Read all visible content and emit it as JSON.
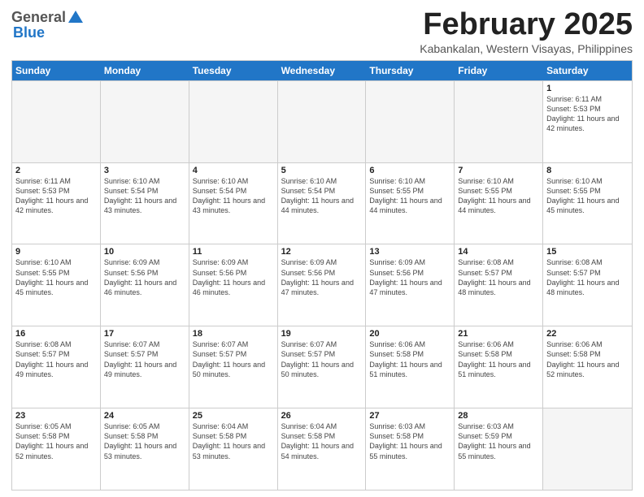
{
  "header": {
    "logo_general": "General",
    "logo_blue": "Blue",
    "month_title": "February 2025",
    "location": "Kabankalan, Western Visayas, Philippines"
  },
  "calendar": {
    "days_of_week": [
      "Sunday",
      "Monday",
      "Tuesday",
      "Wednesday",
      "Thursday",
      "Friday",
      "Saturday"
    ],
    "rows": [
      [
        {
          "day": "",
          "info": "",
          "empty": true
        },
        {
          "day": "",
          "info": "",
          "empty": true
        },
        {
          "day": "",
          "info": "",
          "empty": true
        },
        {
          "day": "",
          "info": "",
          "empty": true
        },
        {
          "day": "",
          "info": "",
          "empty": true
        },
        {
          "day": "",
          "info": "",
          "empty": true
        },
        {
          "day": "1",
          "info": "Sunrise: 6:11 AM\nSunset: 5:53 PM\nDaylight: 11 hours and 42 minutes.",
          "empty": false
        }
      ],
      [
        {
          "day": "2",
          "info": "Sunrise: 6:11 AM\nSunset: 5:53 PM\nDaylight: 11 hours and 42 minutes.",
          "empty": false
        },
        {
          "day": "3",
          "info": "Sunrise: 6:10 AM\nSunset: 5:54 PM\nDaylight: 11 hours and 43 minutes.",
          "empty": false
        },
        {
          "day": "4",
          "info": "Sunrise: 6:10 AM\nSunset: 5:54 PM\nDaylight: 11 hours and 43 minutes.",
          "empty": false
        },
        {
          "day": "5",
          "info": "Sunrise: 6:10 AM\nSunset: 5:54 PM\nDaylight: 11 hours and 44 minutes.",
          "empty": false
        },
        {
          "day": "6",
          "info": "Sunrise: 6:10 AM\nSunset: 5:55 PM\nDaylight: 11 hours and 44 minutes.",
          "empty": false
        },
        {
          "day": "7",
          "info": "Sunrise: 6:10 AM\nSunset: 5:55 PM\nDaylight: 11 hours and 44 minutes.",
          "empty": false
        },
        {
          "day": "8",
          "info": "Sunrise: 6:10 AM\nSunset: 5:55 PM\nDaylight: 11 hours and 45 minutes.",
          "empty": false
        }
      ],
      [
        {
          "day": "9",
          "info": "Sunrise: 6:10 AM\nSunset: 5:55 PM\nDaylight: 11 hours and 45 minutes.",
          "empty": false
        },
        {
          "day": "10",
          "info": "Sunrise: 6:09 AM\nSunset: 5:56 PM\nDaylight: 11 hours and 46 minutes.",
          "empty": false
        },
        {
          "day": "11",
          "info": "Sunrise: 6:09 AM\nSunset: 5:56 PM\nDaylight: 11 hours and 46 minutes.",
          "empty": false
        },
        {
          "day": "12",
          "info": "Sunrise: 6:09 AM\nSunset: 5:56 PM\nDaylight: 11 hours and 47 minutes.",
          "empty": false
        },
        {
          "day": "13",
          "info": "Sunrise: 6:09 AM\nSunset: 5:56 PM\nDaylight: 11 hours and 47 minutes.",
          "empty": false
        },
        {
          "day": "14",
          "info": "Sunrise: 6:08 AM\nSunset: 5:57 PM\nDaylight: 11 hours and 48 minutes.",
          "empty": false
        },
        {
          "day": "15",
          "info": "Sunrise: 6:08 AM\nSunset: 5:57 PM\nDaylight: 11 hours and 48 minutes.",
          "empty": false
        }
      ],
      [
        {
          "day": "16",
          "info": "Sunrise: 6:08 AM\nSunset: 5:57 PM\nDaylight: 11 hours and 49 minutes.",
          "empty": false
        },
        {
          "day": "17",
          "info": "Sunrise: 6:07 AM\nSunset: 5:57 PM\nDaylight: 11 hours and 49 minutes.",
          "empty": false
        },
        {
          "day": "18",
          "info": "Sunrise: 6:07 AM\nSunset: 5:57 PM\nDaylight: 11 hours and 50 minutes.",
          "empty": false
        },
        {
          "day": "19",
          "info": "Sunrise: 6:07 AM\nSunset: 5:57 PM\nDaylight: 11 hours and 50 minutes.",
          "empty": false
        },
        {
          "day": "20",
          "info": "Sunrise: 6:06 AM\nSunset: 5:58 PM\nDaylight: 11 hours and 51 minutes.",
          "empty": false
        },
        {
          "day": "21",
          "info": "Sunrise: 6:06 AM\nSunset: 5:58 PM\nDaylight: 11 hours and 51 minutes.",
          "empty": false
        },
        {
          "day": "22",
          "info": "Sunrise: 6:06 AM\nSunset: 5:58 PM\nDaylight: 11 hours and 52 minutes.",
          "empty": false
        }
      ],
      [
        {
          "day": "23",
          "info": "Sunrise: 6:05 AM\nSunset: 5:58 PM\nDaylight: 11 hours and 52 minutes.",
          "empty": false
        },
        {
          "day": "24",
          "info": "Sunrise: 6:05 AM\nSunset: 5:58 PM\nDaylight: 11 hours and 53 minutes.",
          "empty": false
        },
        {
          "day": "25",
          "info": "Sunrise: 6:04 AM\nSunset: 5:58 PM\nDaylight: 11 hours and 53 minutes.",
          "empty": false
        },
        {
          "day": "26",
          "info": "Sunrise: 6:04 AM\nSunset: 5:58 PM\nDaylight: 11 hours and 54 minutes.",
          "empty": false
        },
        {
          "day": "27",
          "info": "Sunrise: 6:03 AM\nSunset: 5:58 PM\nDaylight: 11 hours and 55 minutes.",
          "empty": false
        },
        {
          "day": "28",
          "info": "Sunrise: 6:03 AM\nSunset: 5:59 PM\nDaylight: 11 hours and 55 minutes.",
          "empty": false
        },
        {
          "day": "",
          "info": "",
          "empty": true
        }
      ]
    ]
  }
}
